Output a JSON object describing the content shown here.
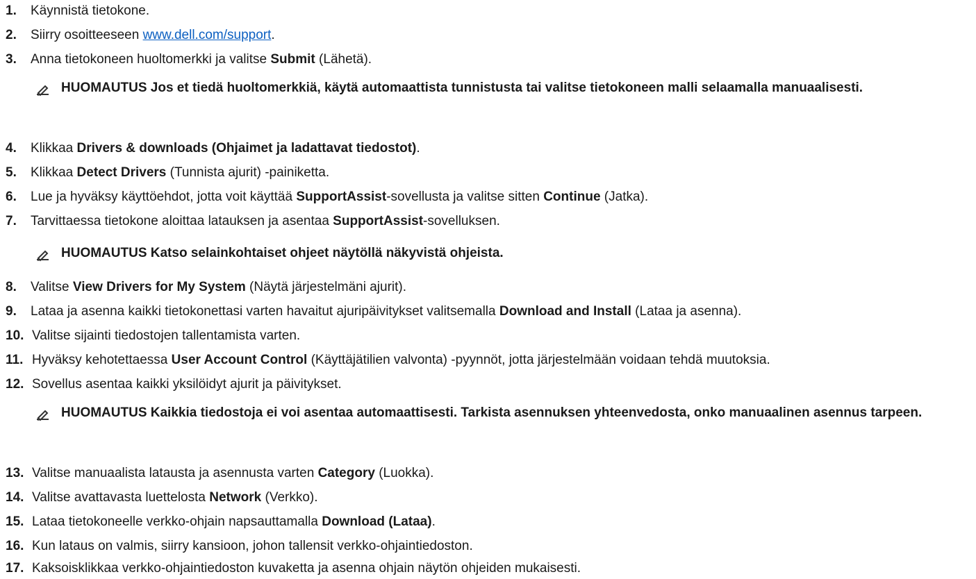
{
  "steps": [
    {
      "num": "1.",
      "text": "Käynnistä tietokone."
    },
    {
      "num": "2.",
      "pre": "Siirry osoitteeseen ",
      "link": "www.dell.com/support",
      "post": "."
    },
    {
      "num": "3.",
      "pre": "Anna tietokoneen huoltomerkki ja valitse ",
      "bold": "Submit",
      "post": " (Lähetä)."
    },
    {
      "num": "4.",
      "pre": "Klikkaa ",
      "bold": "Drivers & downloads (Ohjaimet ja ladattavat tiedostot)",
      "post": "."
    },
    {
      "num": "5.",
      "pre": "Klikkaa ",
      "bold": "Detect Drivers",
      "post": " (Tunnista ajurit) -painiketta."
    },
    {
      "num": "6.",
      "pre": "Lue ja hyväksy käyttöehdot, jotta voit käyttää ",
      "bold": "SupportAssist",
      "mid": "-sovellusta ja valitse sitten ",
      "bold2": "Continue",
      "post": " (Jatka)."
    },
    {
      "num": "7.",
      "pre": "Tarvittaessa tietokone aloittaa latauksen ja asentaa ",
      "bold": "SupportAssist",
      "post": "-sovelluksen."
    },
    {
      "num": "8.",
      "pre": "Valitse ",
      "bold": "View Drivers for My System",
      "post": " (Näytä järjestelmäni ajurit)."
    },
    {
      "num": "9.",
      "pre": "Lataa ja asenna kaikki tietokonettasi varten havaitut ajuripäivitykset valitsemalla ",
      "bold": "Download and Install",
      "post": " (Lataa ja asenna)."
    },
    {
      "num": "10.",
      "text": "Valitse sijainti tiedostojen tallentamista varten."
    },
    {
      "num": "11.",
      "pre": "Hyväksy kehotettaessa ",
      "bold": "User Account Control",
      "post": " (Käyttäjätilien valvonta) -pyynnöt, jotta järjestelmään voidaan tehdä muutoksia."
    },
    {
      "num": "12.",
      "text": "Sovellus asentaa kaikki yksilöidyt ajurit ja päivitykset."
    },
    {
      "num": "13.",
      "pre": "Valitse manuaalista latausta ja asennusta varten ",
      "bold": "Category",
      "post": " (Luokka)."
    },
    {
      "num": "14.",
      "pre": "Valitse avattavasta luettelosta ",
      "bold": "Network",
      "post": " (Verkko)."
    },
    {
      "num": "15.",
      "pre": "Lataa tietokoneelle verkko-ohjain napsauttamalla ",
      "bold": "Download (Lataa)",
      "post": "."
    },
    {
      "num": "16.",
      "text": "Kun lataus on valmis, siirry kansioon, johon tallensit verkko-ohjaintiedoston."
    },
    {
      "num": "17.",
      "text": "Kaksoisklikkaa verkko-ohjaintiedoston kuvaketta ja asenna ohjain näytön ohjeiden mukaisesti."
    }
  ],
  "notes": [
    {
      "text": "HUOMAUTUS Jos et tiedä huoltomerkkiä, käytä automaattista tunnistusta tai valitse tietokoneen malli selaamalla manuaalisesti.",
      "icon": "pencil-note-icon"
    },
    {
      "text": "HUOMAUTUS Katso selainkohtaiset ohjeet näytöllä näkyvistä ohjeista.",
      "icon": "pencil-note-icon"
    },
    {
      "text": "HUOMAUTUS Kaikkia tiedostoja ei voi asentaa automaattisesti. Tarkista asennuksen yhteenvedosta, onko manuaalinen asennus tarpeen.",
      "icon": "pencil-note-icon"
    }
  ],
  "colors": {
    "text": "#1a1a1a",
    "link": "#0b5fc1",
    "icon": "#333333"
  }
}
